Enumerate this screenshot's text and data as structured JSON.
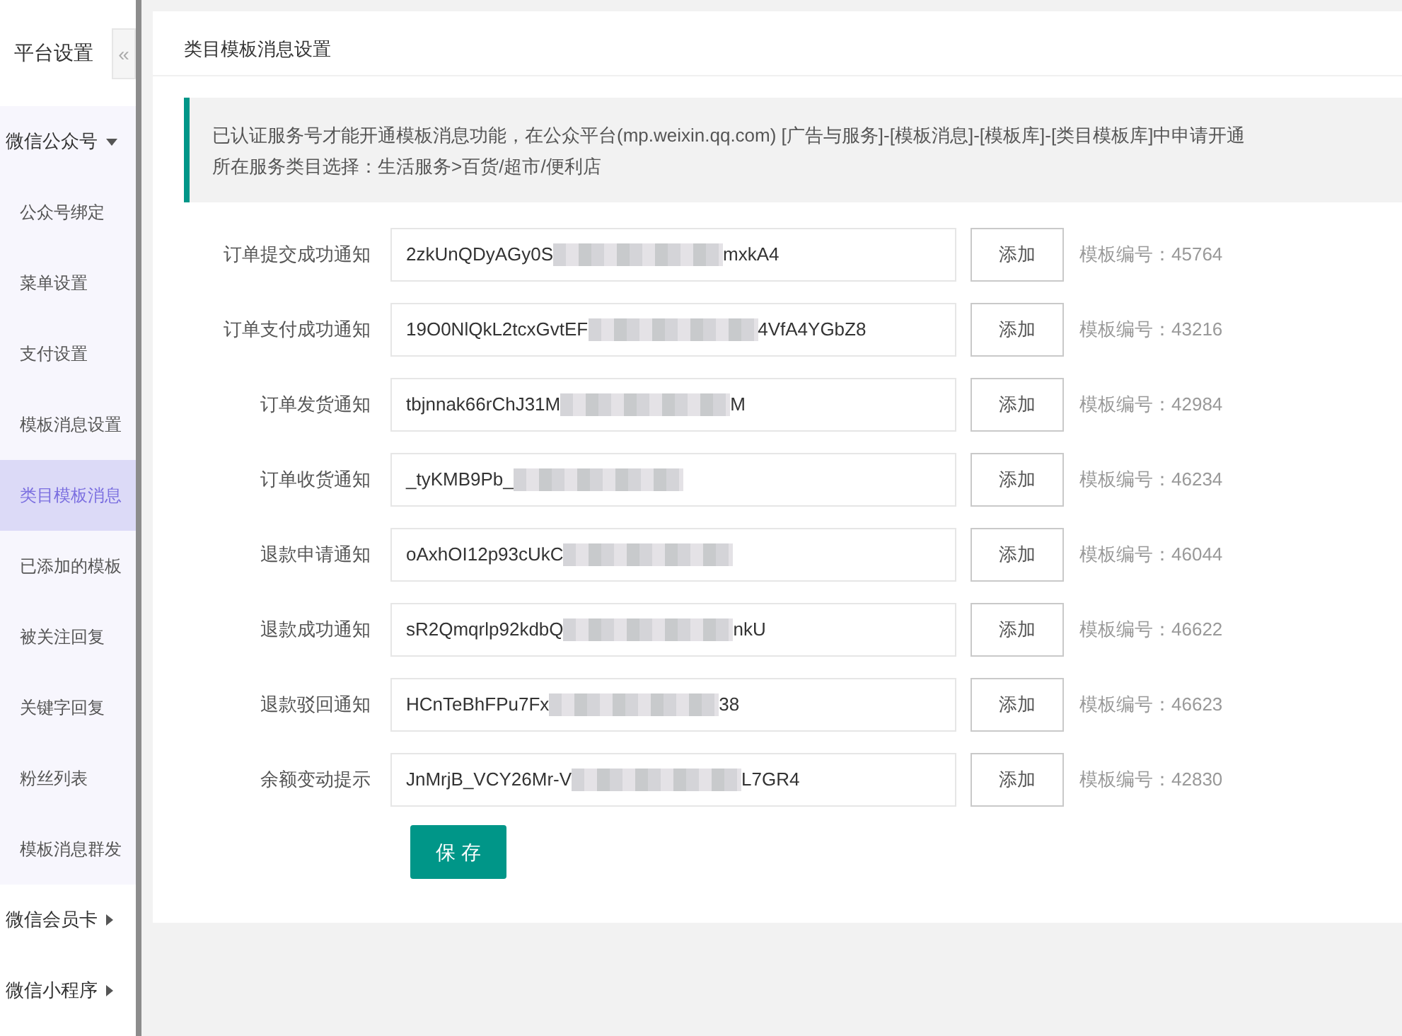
{
  "sidebar": {
    "title": "平台设置",
    "collapse_glyph": "«",
    "groups": [
      {
        "label": "微信公众号",
        "expanded": true,
        "items": [
          {
            "label": "公众号绑定",
            "selected": false
          },
          {
            "label": "菜单设置",
            "selected": false
          },
          {
            "label": "支付设置",
            "selected": false
          },
          {
            "label": "模板消息设置",
            "selected": false
          },
          {
            "label": "类目模板消息",
            "selected": true
          },
          {
            "label": "已添加的模板",
            "selected": false
          },
          {
            "label": "被关注回复",
            "selected": false
          },
          {
            "label": "关键字回复",
            "selected": false
          },
          {
            "label": "粉丝列表",
            "selected": false
          },
          {
            "label": "模板消息群发",
            "selected": false
          }
        ]
      },
      {
        "label": "微信会员卡",
        "expanded": false
      },
      {
        "label": "微信小程序",
        "expanded": false
      }
    ]
  },
  "panel": {
    "title": "类目模板消息设置",
    "notice": [
      "已认证服务号才能开通模板消息功能，在公众平台(mp.weixin.qq.com) [广告与服务]-[模板消息]-[模板库]-[类目模板库]中申请开通",
      "所在服务类目选择：生活服务>百货/超市/便利店"
    ],
    "rows": [
      {
        "label": "订单提交成功通知",
        "value_start": "2zkUnQDyAGy0S",
        "value_end": "mxkA4",
        "button": "添加",
        "hint": "模板编号：45764"
      },
      {
        "label": "订单支付成功通知",
        "value_start": "19O0NlQkL2tcxGvtEF",
        "value_end": "4VfA4YGbZ8",
        "button": "添加",
        "hint": "模板编号：43216"
      },
      {
        "label": "订单发货通知",
        "value_start": "tbjnnak66rChJ31M",
        "value_end": "M",
        "button": "添加",
        "hint": "模板编号：42984"
      },
      {
        "label": "订单收货通知",
        "value_start": "_tyKMB9Pb_",
        "button": "添加",
        "hint": "模板编号：46234"
      },
      {
        "label": "退款申请通知",
        "value_start": "oAxhOI12p93cUkC",
        "button": "添加",
        "hint": "模板编号：46044"
      },
      {
        "label": "退款成功通知",
        "value_start": "sR2Qmqrlp92kdbQ",
        "value_end": "nkU",
        "button": "添加",
        "hint": "模板编号：46622"
      },
      {
        "label": "退款驳回通知",
        "value_start": "HCnTeBhFPu7Fx",
        "value_end": "38",
        "button": "添加",
        "hint": "模板编号：46623"
      },
      {
        "label": "余额变动提示",
        "value_start": "JnMrjB_VCY26Mr-V",
        "value_end": "L7GR4",
        "button": "添加",
        "hint": "模板编号：42830"
      }
    ],
    "save_button": "保 存"
  }
}
